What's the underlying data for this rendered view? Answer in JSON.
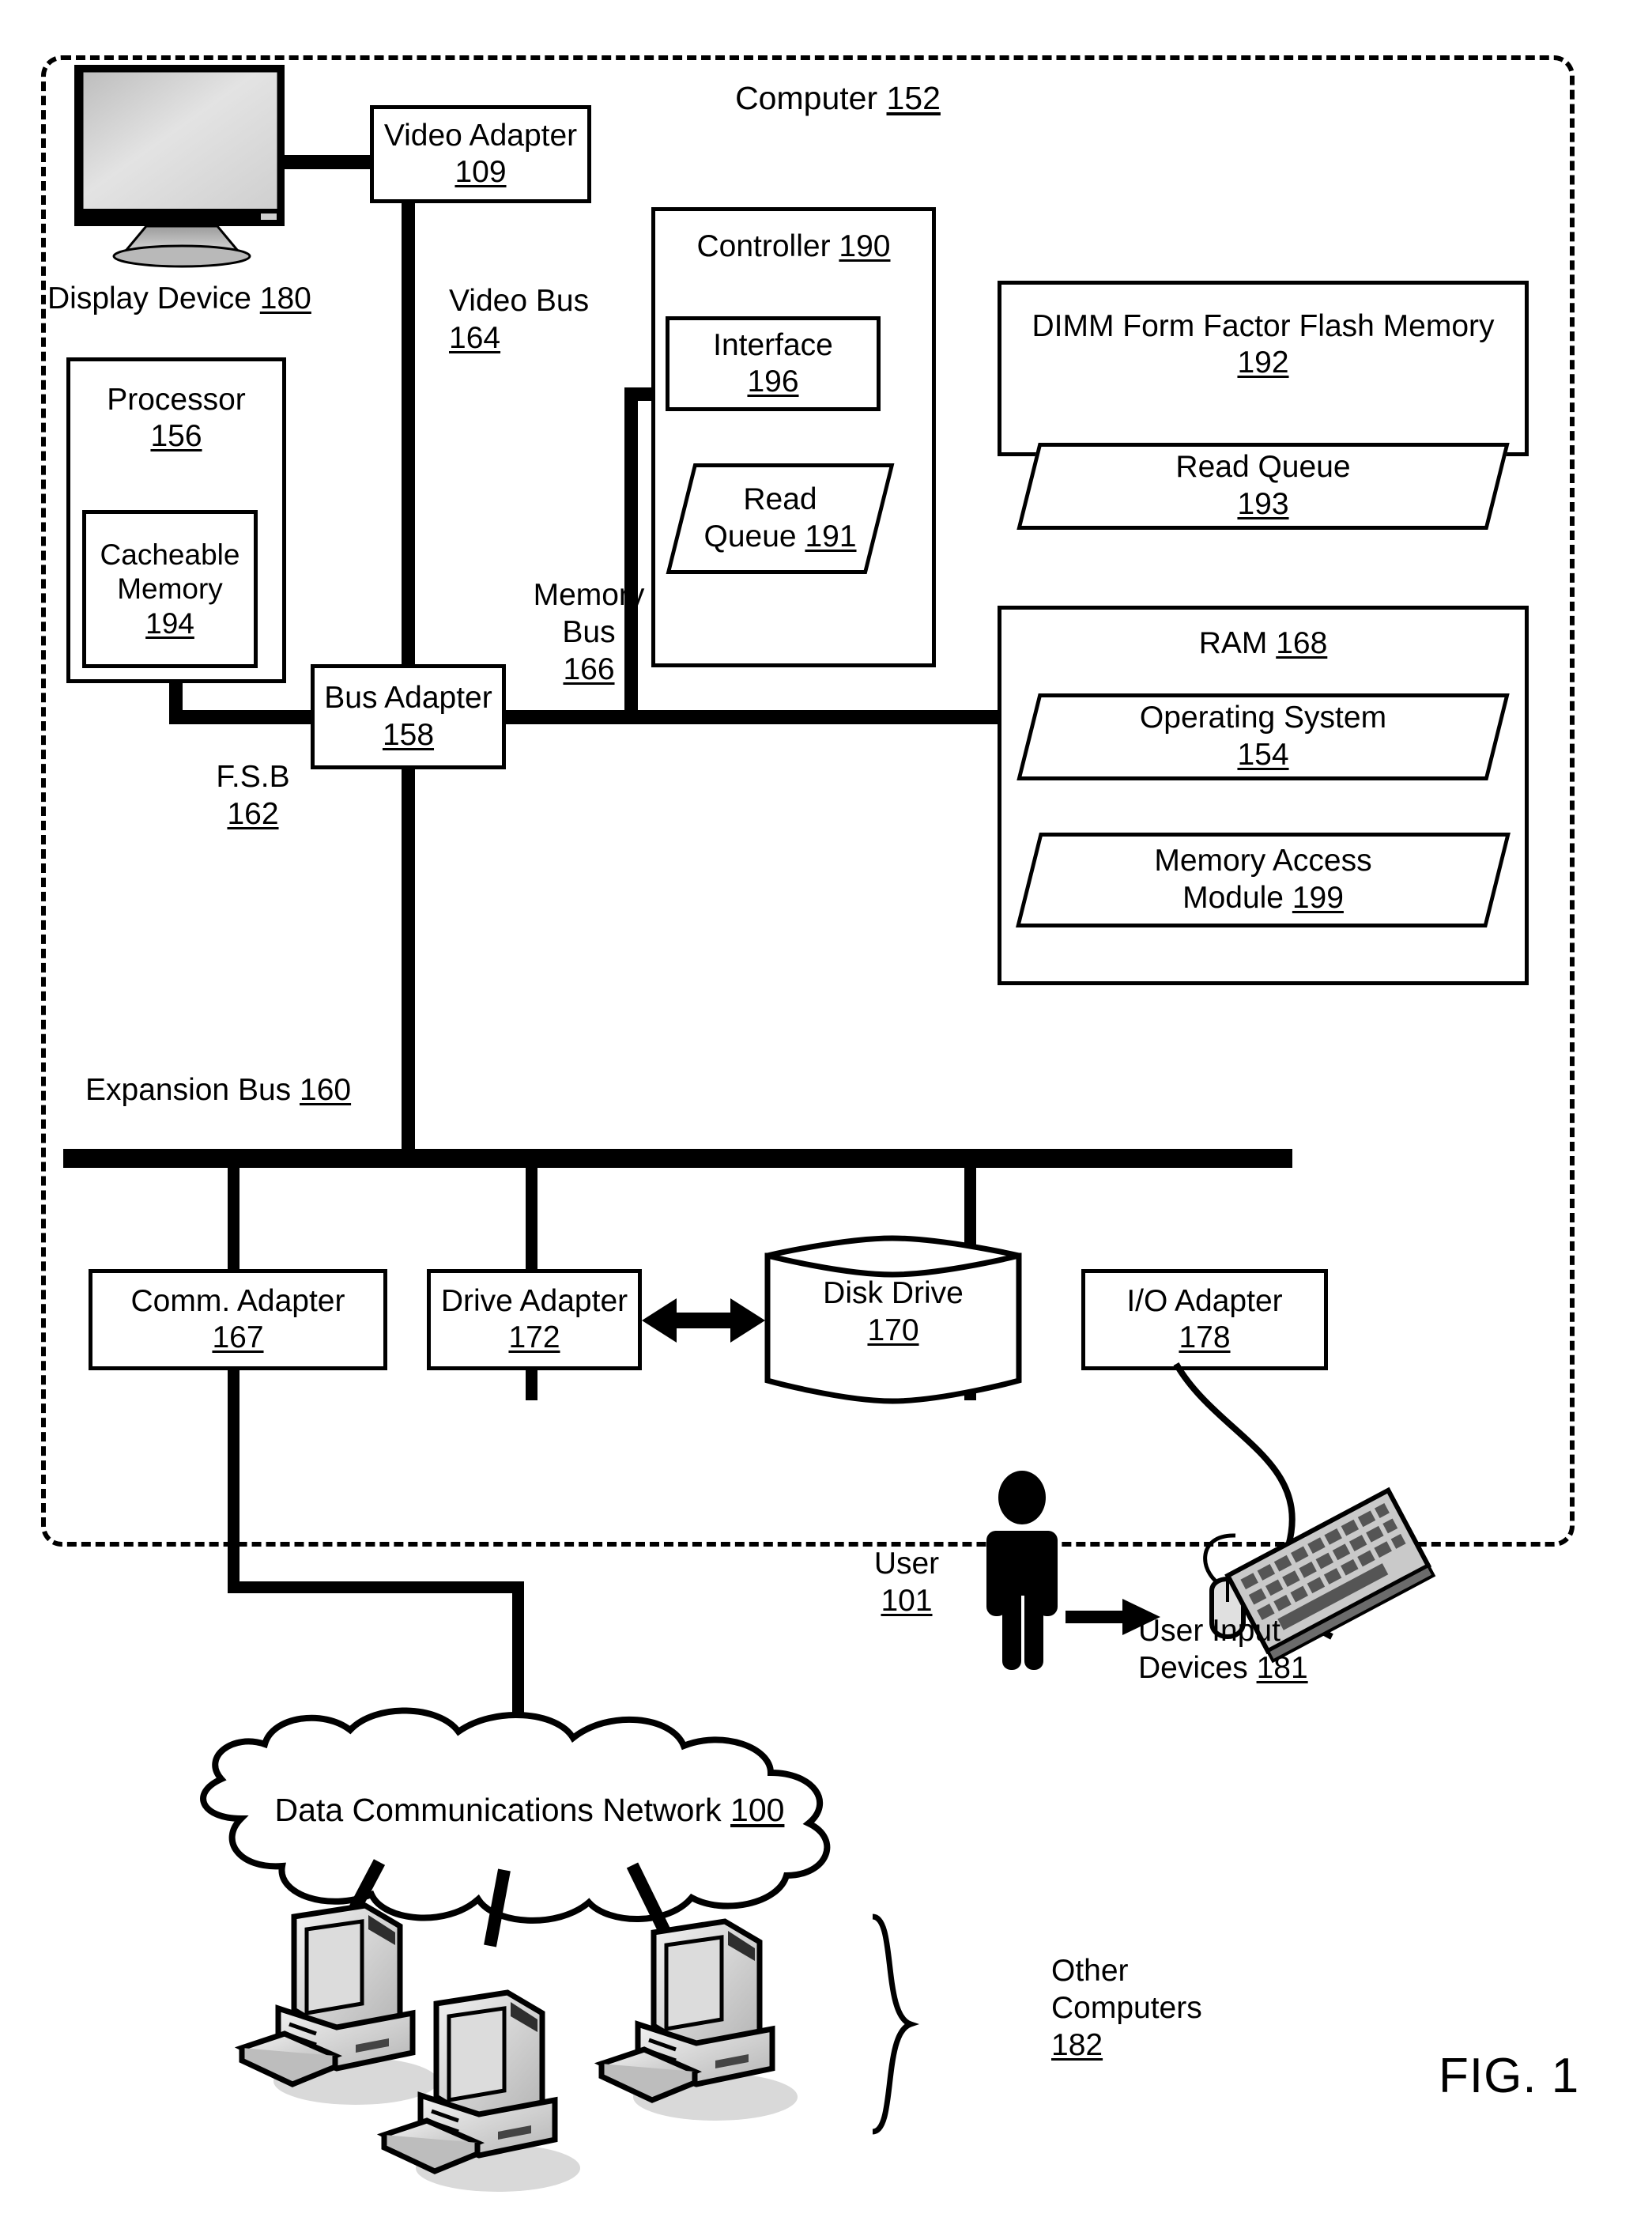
{
  "figure": {
    "caption": "FIG. 1"
  },
  "enclosure": {
    "title": "Computer",
    "ref": "152"
  },
  "display": {
    "label": "Display Device",
    "ref": "180",
    "icon": "crt-monitor-icon"
  },
  "blocks": {
    "video_adapter": {
      "line1": "Video Adapter",
      "ref": "109"
    },
    "processor": {
      "line1": "Processor",
      "ref": "156"
    },
    "cacheable_memory": {
      "line1": "Cacheable",
      "line2": "Memory",
      "ref": "194"
    },
    "bus_adapter": {
      "line1": "Bus Adapter",
      "ref": "158"
    },
    "controller": {
      "line1": "Controller",
      "ref": "190"
    },
    "interface": {
      "line1": "Interface",
      "ref": "196"
    },
    "controller_read_queue": {
      "line1": "Read",
      "line2": "Queue",
      "ref": "191"
    },
    "flash_memory": {
      "line1": "DIMM Form Factor Flash Memory",
      "ref": "192"
    },
    "flash_read_queue": {
      "line1": "Read Queue",
      "ref": "193"
    },
    "ram": {
      "line1": "RAM",
      "ref": "168"
    },
    "operating_system": {
      "line1": "Operating System",
      "ref": "154"
    },
    "memory_access_module": {
      "line1": "Memory Access",
      "line2": "Module",
      "ref": "199"
    },
    "comm_adapter": {
      "line1": "Comm. Adapter",
      "ref": "167"
    },
    "drive_adapter": {
      "line1": "Drive Adapter",
      "ref": "172"
    },
    "disk_drive": {
      "line1": "Disk Drive",
      "ref": "170"
    },
    "io_adapter": {
      "line1": "I/O Adapter",
      "ref": "178"
    }
  },
  "buses": {
    "video_bus": {
      "line1": "Video Bus",
      "ref": "164"
    },
    "memory_bus": {
      "line1": "Memory",
      "line2": "Bus",
      "ref": "166"
    },
    "fsb": {
      "line1": "F.S.B",
      "ref": "162"
    },
    "expansion_bus": {
      "line1": "Expansion Bus",
      "ref": "160"
    }
  },
  "external": {
    "user": {
      "label": "User",
      "ref": "101",
      "icon": "person-icon"
    },
    "user_input_devices": {
      "line1": "User Input",
      "line2": "Devices",
      "ref": "181",
      "icon": "keyboard-mouse-icon"
    },
    "network": {
      "label": "Data Communications Network",
      "ref": "100",
      "icon": "cloud-icon"
    },
    "other_computers": {
      "line1": "Other",
      "line2": "Computers",
      "ref": "182",
      "icon": "desktop-computer-icon"
    }
  },
  "colors": {
    "ink": "#000000",
    "paper": "#ffffff",
    "screen_fill": "#d6d6d6"
  }
}
